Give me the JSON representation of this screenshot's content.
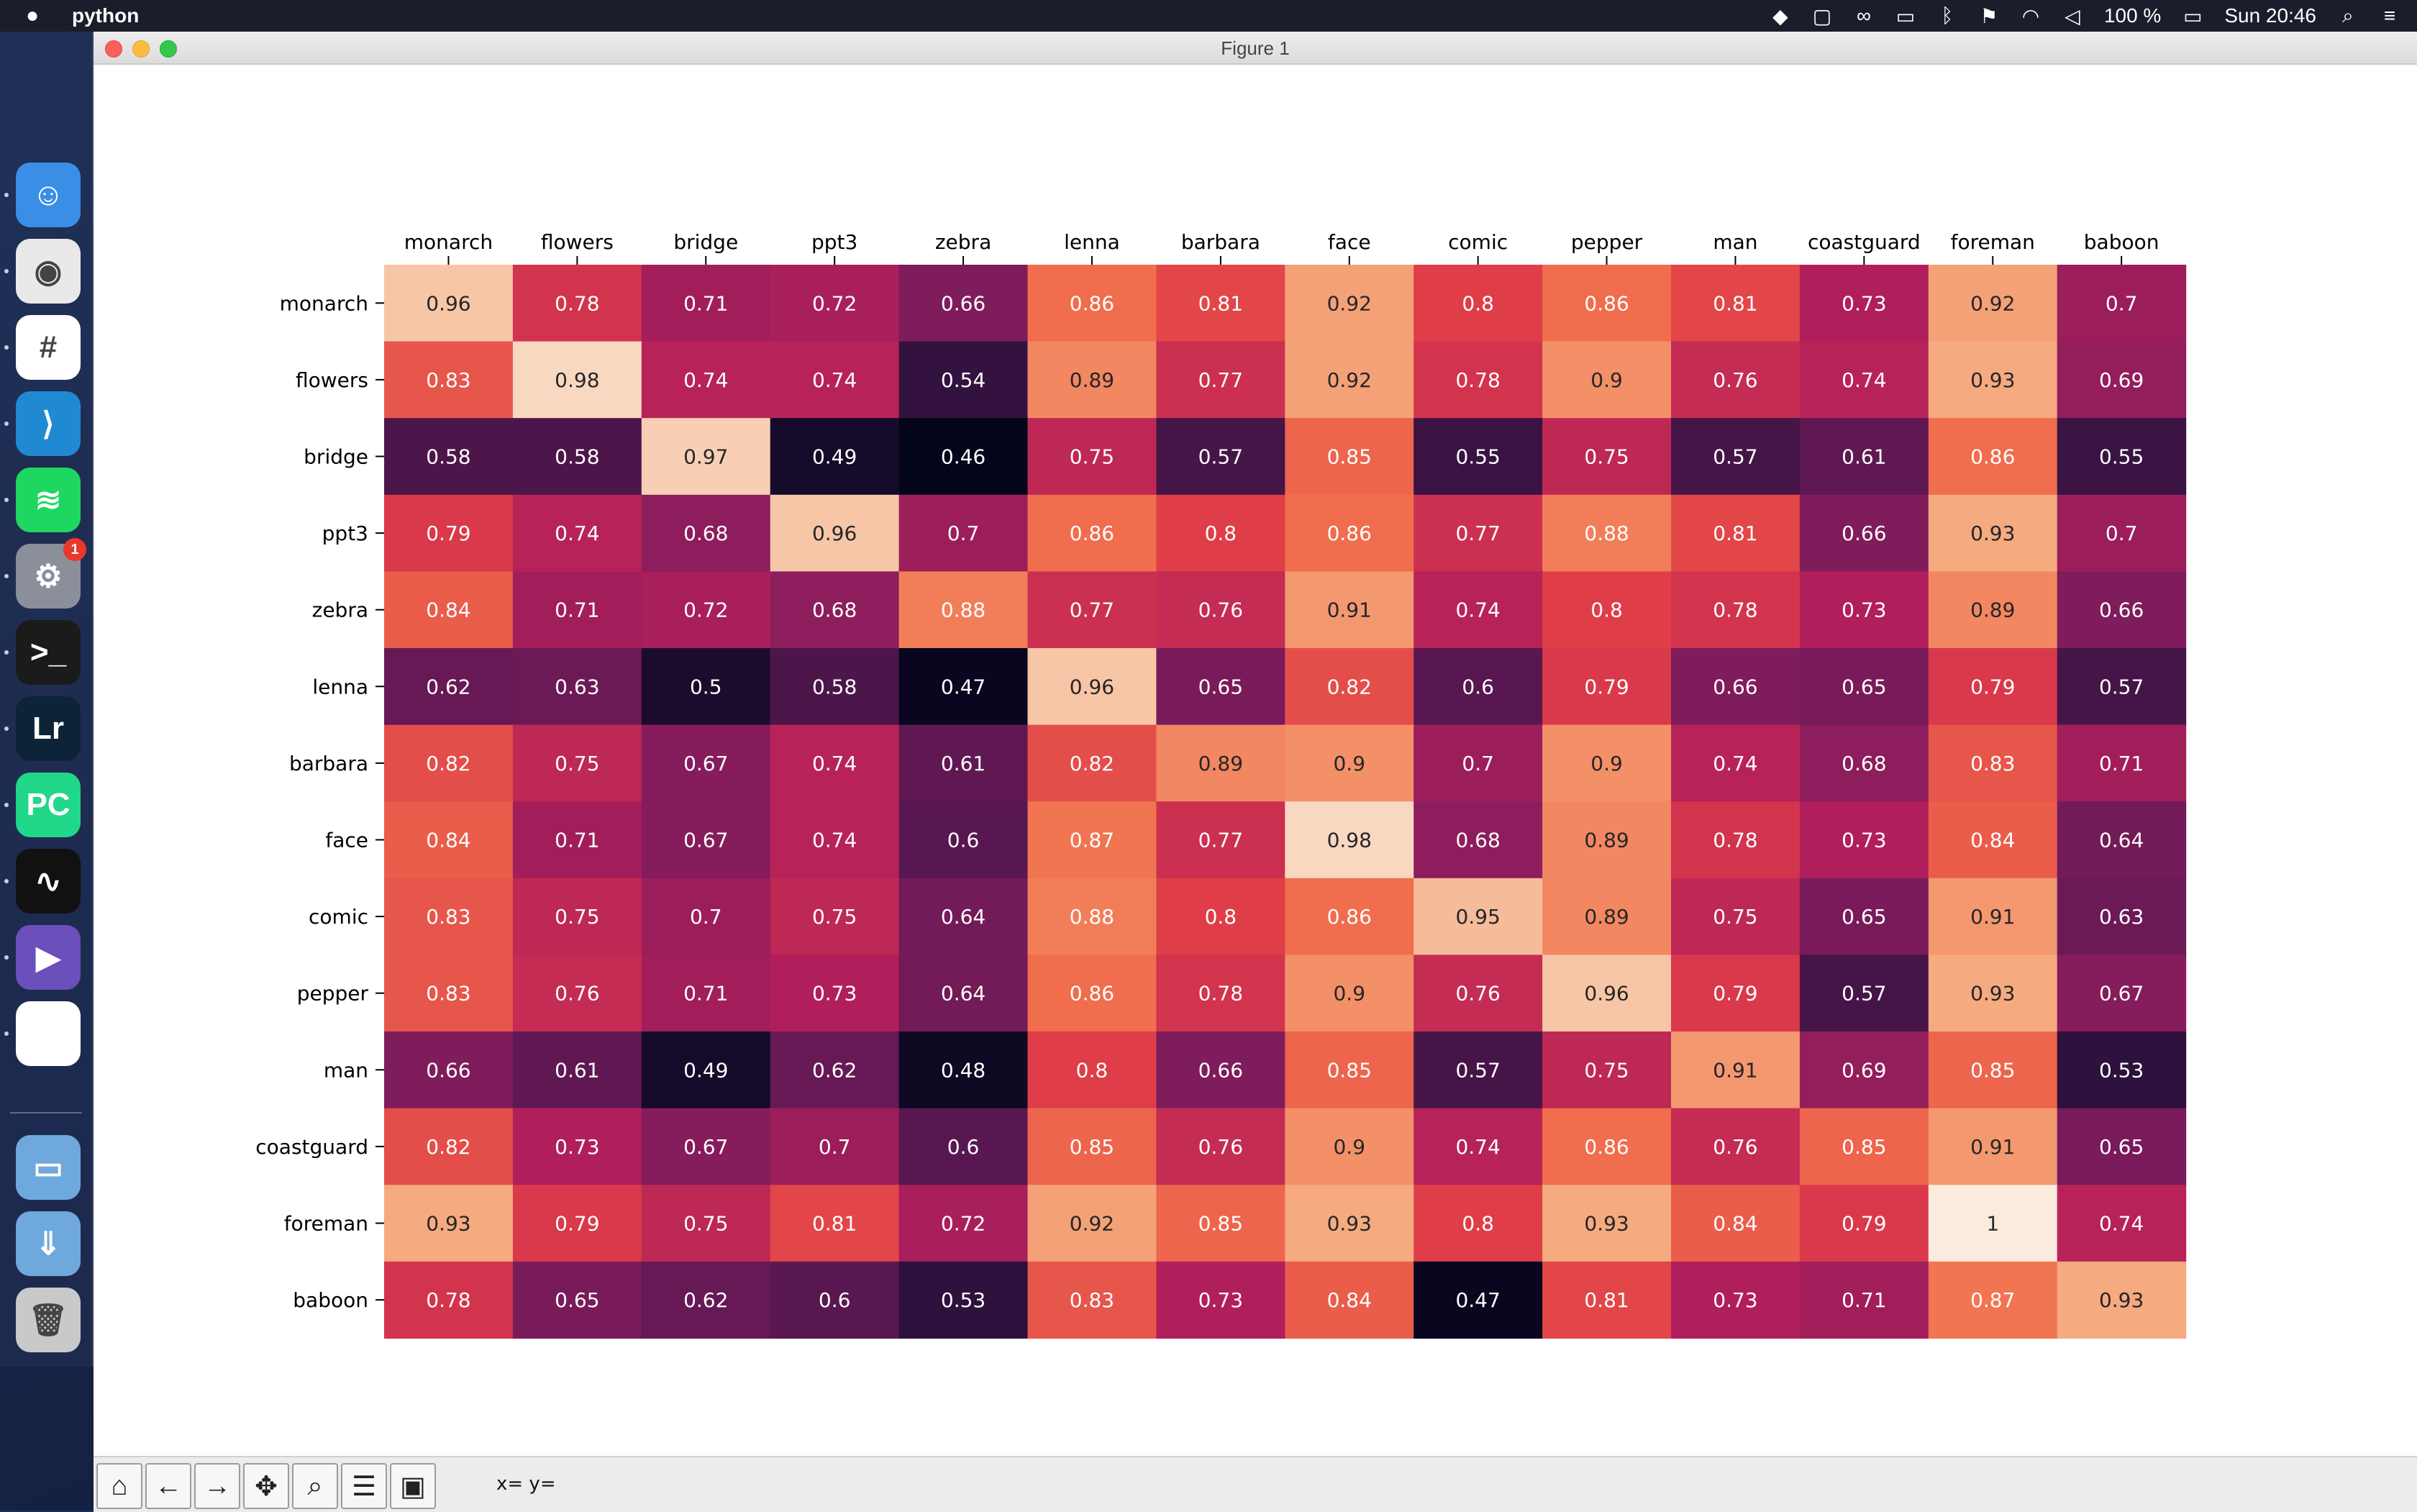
{
  "menubar": {
    "apple_icon": "apple-logo-icon",
    "app_name": "python",
    "battery_percent": "100 %",
    "clock": "Sun 20:46",
    "icons": [
      "location-arrow-icon",
      "screen-share-icon",
      "glasses-icon",
      "airplay-icon",
      "bluetooth-icon",
      "us-flag-icon",
      "wifi-icon",
      "volume-icon",
      "battery-icon",
      "search-icon",
      "control-center-icon"
    ]
  },
  "dock": {
    "items": [
      {
        "name": "finder-icon",
        "glyph": "☺",
        "bg": "#3a8ee6"
      },
      {
        "name": "chrome-icon",
        "glyph": "◉",
        "bg": "#e9e9e9"
      },
      {
        "name": "slack-icon",
        "glyph": "#",
        "bg": "#ffffff"
      },
      {
        "name": "vscode-icon",
        "glyph": "⟩",
        "bg": "#1f8ad2"
      },
      {
        "name": "spotify-icon",
        "glyph": "≋",
        "bg": "#1ed760"
      },
      {
        "name": "system-preferences-icon",
        "glyph": "⚙",
        "bg": "#8a8f99",
        "badge": "1"
      },
      {
        "name": "terminal-icon",
        "glyph": ">_",
        "bg": "#1b1b1b"
      },
      {
        "name": "lightroom-icon",
        "glyph": "Lr",
        "bg": "#0c2338"
      },
      {
        "name": "pycharm-icon",
        "glyph": "PC",
        "bg": "#21d789"
      },
      {
        "name": "activity-monitor-icon",
        "glyph": "∿",
        "bg": "#111"
      },
      {
        "name": "media-player-icon",
        "glyph": "▶",
        "bg": "#6b4fbb"
      },
      {
        "name": "document-icon",
        "glyph": "",
        "bg": "#ffffff"
      },
      {
        "name": "folder-icon",
        "glyph": "▭",
        "bg": "#6fa8dc"
      },
      {
        "name": "downloads-folder-icon",
        "glyph": "⇓",
        "bg": "#6fa8dc"
      },
      {
        "name": "trash-icon",
        "glyph": "🗑",
        "bg": "#c9c9c9"
      }
    ]
  },
  "window": {
    "title": "Figure 1"
  },
  "toolbar": {
    "buttons": [
      {
        "name": "home-button",
        "glyph": "⌂"
      },
      {
        "name": "back-button",
        "glyph": "←"
      },
      {
        "name": "forward-button",
        "glyph": "→"
      },
      {
        "name": "pan-button",
        "glyph": "✥"
      },
      {
        "name": "zoom-button",
        "glyph": "⌕"
      },
      {
        "name": "configure-subplots-button",
        "glyph": "☰"
      },
      {
        "name": "save-button",
        "glyph": "▣"
      }
    ],
    "coords_text": "x= y="
  },
  "chart_data": {
    "type": "heatmap",
    "x_labels": [
      "monarch",
      "flowers",
      "bridge",
      "ppt3",
      "zebra",
      "lenna",
      "barbara",
      "face",
      "comic",
      "pepper",
      "man",
      "coastguard",
      "foreman",
      "baboon"
    ],
    "y_labels": [
      "monarch",
      "flowers",
      "bridge",
      "ppt3",
      "zebra",
      "lenna",
      "barbara",
      "face",
      "comic",
      "pepper",
      "man",
      "coastguard",
      "foreman",
      "baboon"
    ],
    "x_axis_position": "top",
    "colormap": "rocket",
    "value_range": [
      0.46,
      1.0
    ],
    "values": [
      [
        0.96,
        0.78,
        0.71,
        0.72,
        0.66,
        0.86,
        0.81,
        0.92,
        0.8,
        0.86,
        0.81,
        0.73,
        0.92,
        0.7
      ],
      [
        0.83,
        0.98,
        0.74,
        0.74,
        0.54,
        0.89,
        0.77,
        0.92,
        0.78,
        0.9,
        0.76,
        0.74,
        0.93,
        0.69
      ],
      [
        0.58,
        0.58,
        0.97,
        0.49,
        0.46,
        0.75,
        0.57,
        0.85,
        0.55,
        0.75,
        0.57,
        0.61,
        0.86,
        0.55
      ],
      [
        0.79,
        0.74,
        0.68,
        0.96,
        0.7,
        0.86,
        0.8,
        0.86,
        0.77,
        0.88,
        0.81,
        0.66,
        0.93,
        0.7
      ],
      [
        0.84,
        0.71,
        0.72,
        0.68,
        0.88,
        0.77,
        0.76,
        0.91,
        0.74,
        0.8,
        0.78,
        0.73,
        0.89,
        0.66
      ],
      [
        0.62,
        0.63,
        0.5,
        0.58,
        0.47,
        0.96,
        0.65,
        0.82,
        0.6,
        0.79,
        0.66,
        0.65,
        0.79,
        0.57
      ],
      [
        0.82,
        0.75,
        0.67,
        0.74,
        0.61,
        0.82,
        0.89,
        0.9,
        0.7,
        0.9,
        0.74,
        0.68,
        0.83,
        0.71
      ],
      [
        0.84,
        0.71,
        0.67,
        0.74,
        0.6,
        0.87,
        0.77,
        0.98,
        0.68,
        0.89,
        0.78,
        0.73,
        0.84,
        0.64
      ],
      [
        0.83,
        0.75,
        0.7,
        0.75,
        0.64,
        0.88,
        0.8,
        0.86,
        0.95,
        0.89,
        0.75,
        0.65,
        0.91,
        0.63
      ],
      [
        0.83,
        0.76,
        0.71,
        0.73,
        0.64,
        0.86,
        0.78,
        0.9,
        0.76,
        0.96,
        0.79,
        0.57,
        0.93,
        0.67
      ],
      [
        0.66,
        0.61,
        0.49,
        0.62,
        0.48,
        0.8,
        0.66,
        0.85,
        0.57,
        0.75,
        0.91,
        0.69,
        0.85,
        0.53
      ],
      [
        0.82,
        0.73,
        0.67,
        0.7,
        0.6,
        0.85,
        0.76,
        0.9,
        0.74,
        0.86,
        0.76,
        0.85,
        0.91,
        0.65
      ],
      [
        0.93,
        0.79,
        0.75,
        0.81,
        0.72,
        0.92,
        0.85,
        0.93,
        0.8,
        0.93,
        0.84,
        0.79,
        1,
        0.74
      ],
      [
        0.78,
        0.65,
        0.62,
        0.6,
        0.53,
        0.83,
        0.73,
        0.84,
        0.47,
        0.81,
        0.73,
        0.71,
        0.87,
        0.93
      ]
    ]
  }
}
